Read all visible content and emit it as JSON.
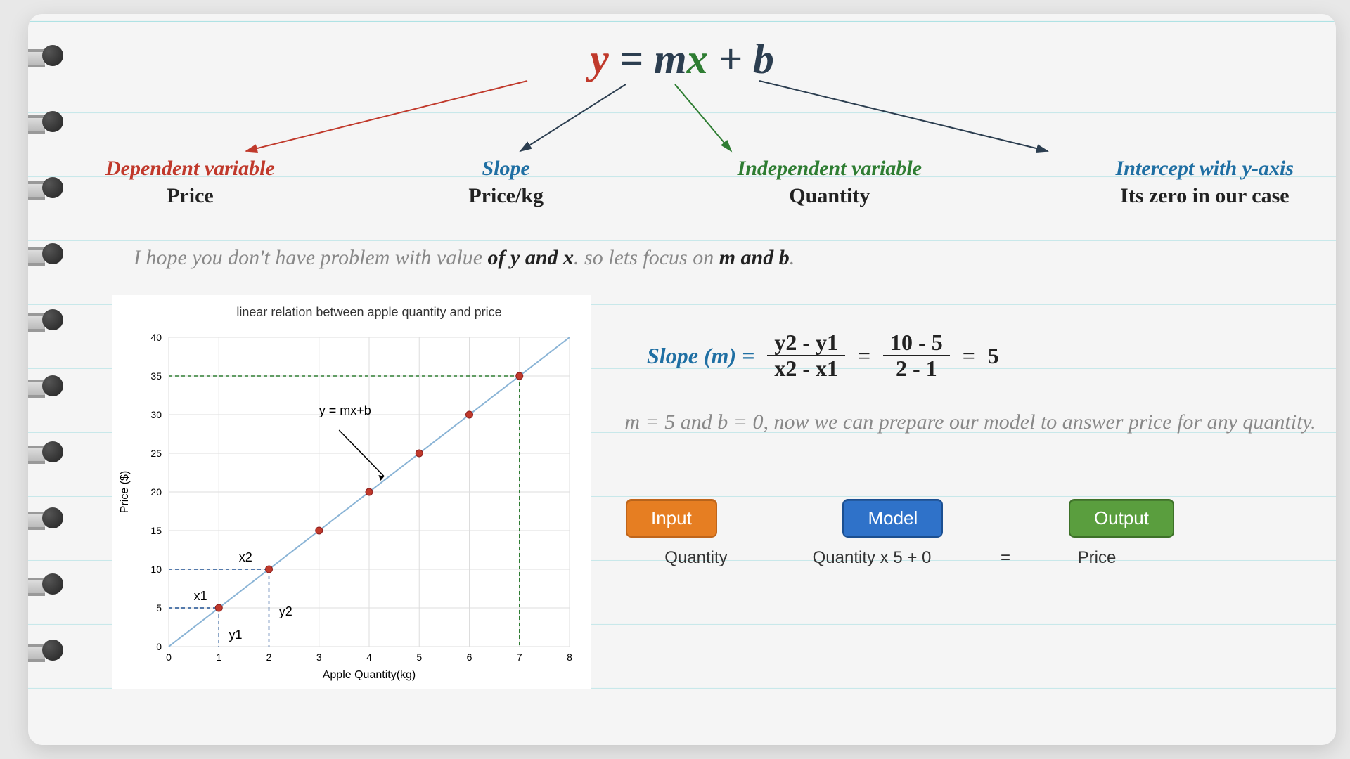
{
  "equation": {
    "y": "y",
    "eq": "=",
    "m": "m",
    "x": "x",
    "plus_b": "+ b"
  },
  "labels": {
    "dep": {
      "title": "Dependent variable",
      "sub": "Price"
    },
    "slope": {
      "title": "Slope",
      "sub": "Price/kg"
    },
    "ind": {
      "title": "Independent variable",
      "sub": "Quantity"
    },
    "intc": {
      "title": "Intercept with y-axis",
      "sub": "Its zero in our case"
    }
  },
  "para1": {
    "a": "I hope you don't have problem with value ",
    "b": "of y and x",
    "c": ". so lets focus on ",
    "d": "m and b",
    "e": "."
  },
  "slope_eq": {
    "lhs": "Slope (m) =",
    "num1": "y2 - y1",
    "den1": "x2 - x1",
    "eq1": "=",
    "num2": "10 - 5",
    "den2": "2 - 1",
    "eq2": "=",
    "ans": "5"
  },
  "para2": "m = 5 and b = 0, now we can prepare our model to answer price for any quantity.",
  "model": {
    "input": "Input",
    "model": "Model",
    "output": "Output",
    "sub_input": "Quantity",
    "sub_model": "Quantity x 5 + 0",
    "sub_eq": "=",
    "sub_output": "Price"
  },
  "chart_data": {
    "type": "scatter",
    "title": "linear relation between apple quantity and price",
    "xlabel": "Apple Quantity(kg)",
    "ylabel": "Price ($)",
    "xlim": [
      0,
      8
    ],
    "ylim": [
      0,
      40
    ],
    "xticks": [
      0,
      1,
      2,
      3,
      4,
      5,
      6,
      7,
      8
    ],
    "yticks": [
      0,
      5,
      10,
      15,
      20,
      25,
      30,
      35,
      40
    ],
    "points": [
      {
        "x": 1,
        "y": 5
      },
      {
        "x": 2,
        "y": 10
      },
      {
        "x": 3,
        "y": 15
      },
      {
        "x": 4,
        "y": 20
      },
      {
        "x": 5,
        "y": 25
      },
      {
        "x": 6,
        "y": 30
      },
      {
        "x": 7,
        "y": 35
      }
    ],
    "line_equation_label": "y = mx+b",
    "annotations": {
      "x1": {
        "label": "x1",
        "at_x": 1
      },
      "x2": {
        "label": "x2",
        "at_x": 2
      },
      "y1": {
        "label": "y1",
        "below_x": 1
      },
      "y2": {
        "label": "y2",
        "below_x": 2
      }
    },
    "dashed_guides": [
      {
        "color": "green",
        "x": 7,
        "y": 35
      },
      {
        "color": "blue",
        "x": 1,
        "y": 5
      },
      {
        "color": "blue",
        "x": 2,
        "y": 10
      }
    ]
  }
}
